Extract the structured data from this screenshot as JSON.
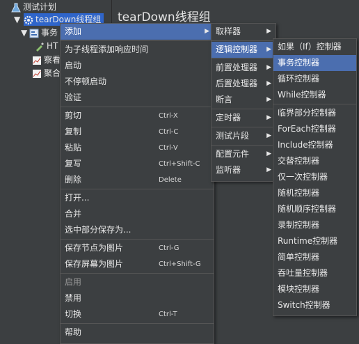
{
  "tree": {
    "items": [
      {
        "label": "测试计划",
        "icon": "beaker-icon"
      },
      {
        "label": "tearDown线程组",
        "icon": "gear-icon"
      },
      {
        "label": "事务",
        "icon": "controller-icon"
      },
      {
        "label": "HT",
        "icon": "pipette-icon"
      },
      {
        "label": "察看",
        "icon": "listener-icon"
      },
      {
        "label": "聚合",
        "icon": "listener-icon"
      }
    ]
  },
  "panel": {
    "title": "tearDown线程组"
  },
  "context_menu": {
    "items": [
      {
        "label": "添加",
        "submenu": true,
        "highlighted": true
      },
      {
        "sep": true
      },
      {
        "label": "为子线程添加响应时间"
      },
      {
        "label": "启动"
      },
      {
        "label": "不停顿启动"
      },
      {
        "label": "验证"
      },
      {
        "sep": true
      },
      {
        "label": "剪切",
        "shortcut": "Ctrl-X"
      },
      {
        "label": "复制",
        "shortcut": "Ctrl-C"
      },
      {
        "label": "粘贴",
        "shortcut": "Ctrl-V"
      },
      {
        "label": "复写",
        "shortcut": "Ctrl+Shift-C"
      },
      {
        "label": "删除",
        "shortcut": "Delete"
      },
      {
        "sep": true
      },
      {
        "label": "打开..."
      },
      {
        "label": "合并"
      },
      {
        "label": "选中部分保存为..."
      },
      {
        "sep": true
      },
      {
        "label": "保存节点为图片",
        "shortcut": "Ctrl-G"
      },
      {
        "label": "保存屏幕为图片",
        "shortcut": "Ctrl+Shift-G"
      },
      {
        "sep": true
      },
      {
        "label": "启用",
        "disabled": true
      },
      {
        "label": "禁用"
      },
      {
        "label": "切换",
        "shortcut": "Ctrl-T"
      },
      {
        "sep": true
      },
      {
        "label": "帮助"
      }
    ]
  },
  "add_submenu": {
    "items": [
      {
        "label": "取样器",
        "submenu": true
      },
      {
        "sep": true
      },
      {
        "label": "逻辑控制器",
        "submenu": true,
        "highlighted": true
      },
      {
        "sep": true
      },
      {
        "label": "前置处理器",
        "submenu": true
      },
      {
        "label": "后置处理器",
        "submenu": true
      },
      {
        "label": "断言",
        "submenu": true
      },
      {
        "sep": true
      },
      {
        "label": "定时器",
        "submenu": true
      },
      {
        "sep": true
      },
      {
        "label": "测试片段",
        "submenu": true
      },
      {
        "sep": true
      },
      {
        "label": "配置元件",
        "submenu": true
      },
      {
        "label": "监听器",
        "submenu": true
      }
    ]
  },
  "logic_submenu": {
    "items": [
      {
        "label": "如果（If）控制器"
      },
      {
        "label": "事务控制器",
        "highlighted": true
      },
      {
        "label": "循环控制器"
      },
      {
        "label": "While控制器"
      },
      {
        "sep": true
      },
      {
        "label": "临界部分控制器"
      },
      {
        "label": "ForEach控制器"
      },
      {
        "label": "Include控制器"
      },
      {
        "label": "交替控制器"
      },
      {
        "label": "仅一次控制器"
      },
      {
        "label": "随机控制器"
      },
      {
        "label": "随机顺序控制器"
      },
      {
        "label": "录制控制器"
      },
      {
        "label": "Runtime控制器"
      },
      {
        "label": "简单控制器"
      },
      {
        "label": "吞吐量控制器"
      },
      {
        "label": "模块控制器"
      },
      {
        "label": "Switch控制器"
      }
    ]
  },
  "colors": {
    "highlight": "#4b6eaf",
    "selection": "#2f65ca",
    "background": "#3c3f41"
  }
}
